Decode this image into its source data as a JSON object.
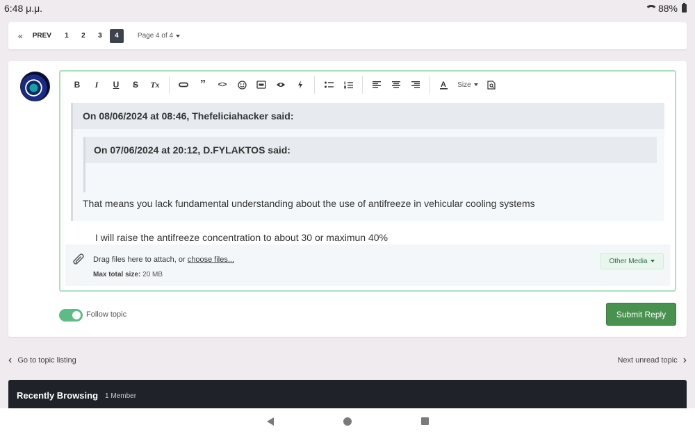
{
  "status_bar": {
    "time": "6:48 μ.μ.",
    "battery": "88%"
  },
  "pagination": {
    "first_icon": "double-chevron-left-icon",
    "prev_label": "PREV",
    "pages": [
      "1",
      "2",
      "3",
      "4"
    ],
    "active_page": "4",
    "jump_label": "Page 4 of 4"
  },
  "editor": {
    "toolbar": {
      "bold": "B",
      "italic": "I",
      "underline": "U",
      "strike": "S",
      "clear_format": "Tx",
      "size_label": "Size"
    },
    "outer_quote": {
      "header": "On 08/06/2024 at 08:46, Thefeliciahacker said:",
      "body": "That means you lack fundamental understanding about the use of antifreeze in vehicular cooling systems"
    },
    "inner_quote": {
      "header": "On 07/06/2024 at 20:12, D.FYLAKTOS said:",
      "body": "I will raise the antifreeze concentration to about 30 or maximun 40%"
    },
    "attach": {
      "drag_text": "Drag files here to attach, or",
      "choose_link": "choose files...",
      "max_label": "Max total size:",
      "max_value": "20 MB",
      "media_button": "Other Media"
    }
  },
  "follow_label": "Follow topic",
  "submit_label": "Submit Reply",
  "nav": {
    "back": "Go to topic listing",
    "next": "Next unread topic"
  },
  "recent": {
    "title": "Recently Browsing",
    "count": "1 Member"
  },
  "colors": {
    "accent_green": "#49914f",
    "editor_border": "#a9e0bd",
    "dark_bar": "#1f2329"
  }
}
